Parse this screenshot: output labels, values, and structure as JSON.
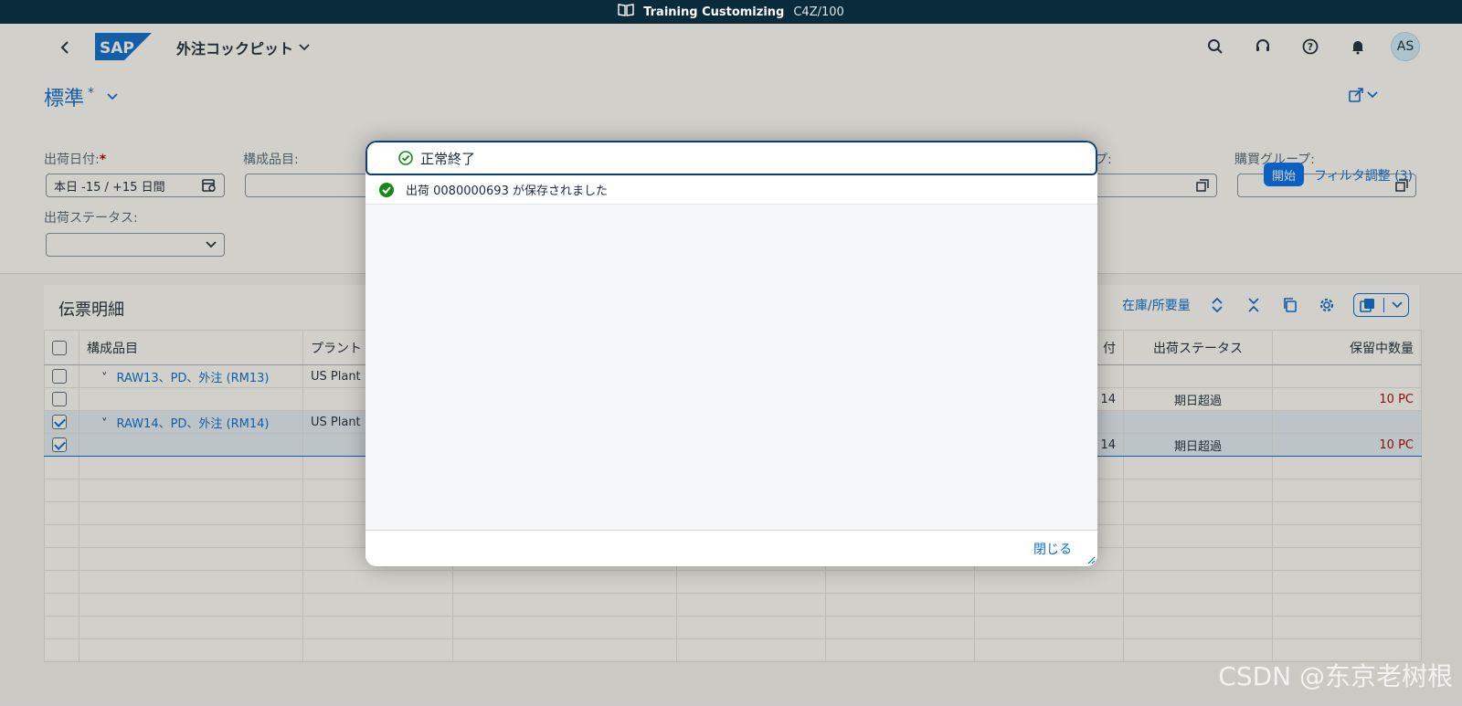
{
  "system": {
    "title": "Training Customizing",
    "client": "C4Z/100"
  },
  "shell": {
    "app_title": "外注コックピット",
    "avatar": "AS"
  },
  "variant": {
    "name": "標準",
    "modified": "*"
  },
  "filters": {
    "ship_date_label": "出荷日付:",
    "ship_date_required": "*",
    "ship_date_value": "本日 -15 / +15 日間",
    "component_label": "構成品目:",
    "group_partial_label": "プ:",
    "purchasing_group_label": "購買グループ:",
    "ship_status_label": "出荷ステータス:",
    "go_label": "開始",
    "adapt_label": "フィルタ調整 (3)"
  },
  "table": {
    "title": "伝票明細",
    "toolbar": {
      "stock_label": "在庫/所要量"
    },
    "headers": [
      "構成品目",
      "プラント",
      "",
      "",
      "",
      "",
      "付",
      "出荷ステータス",
      "保留中数量"
    ],
    "rows": [
      {
        "component": "RAW13、PD、外注 (RM13)",
        "plant": "US Plant",
        "date": "",
        "status": "",
        "qty": "",
        "checked": false,
        "group": true
      },
      {
        "component": "",
        "plant": "",
        "date": "14",
        "status": "期日超過",
        "qty": "10 PC",
        "checked": false,
        "group": false
      },
      {
        "component": "RAW14、PD、外注 (RM14)",
        "plant": "US Plant",
        "date": "",
        "status": "",
        "qty": "",
        "checked": true,
        "group": true
      },
      {
        "component": "",
        "plant": "",
        "date": "14",
        "status": "期日超過",
        "qty": "10 PC",
        "checked": true,
        "group": false
      }
    ]
  },
  "dialog": {
    "title": "正常終了",
    "message": "出荷 0080000693 が保存されました",
    "close_label": "閉じる"
  },
  "colors": {
    "accent": "#0a6ed1",
    "success": "#188918",
    "overdue": "#aa0808",
    "sysbar": "#0a2b3c"
  },
  "watermark": "CSDN @东京老树根"
}
